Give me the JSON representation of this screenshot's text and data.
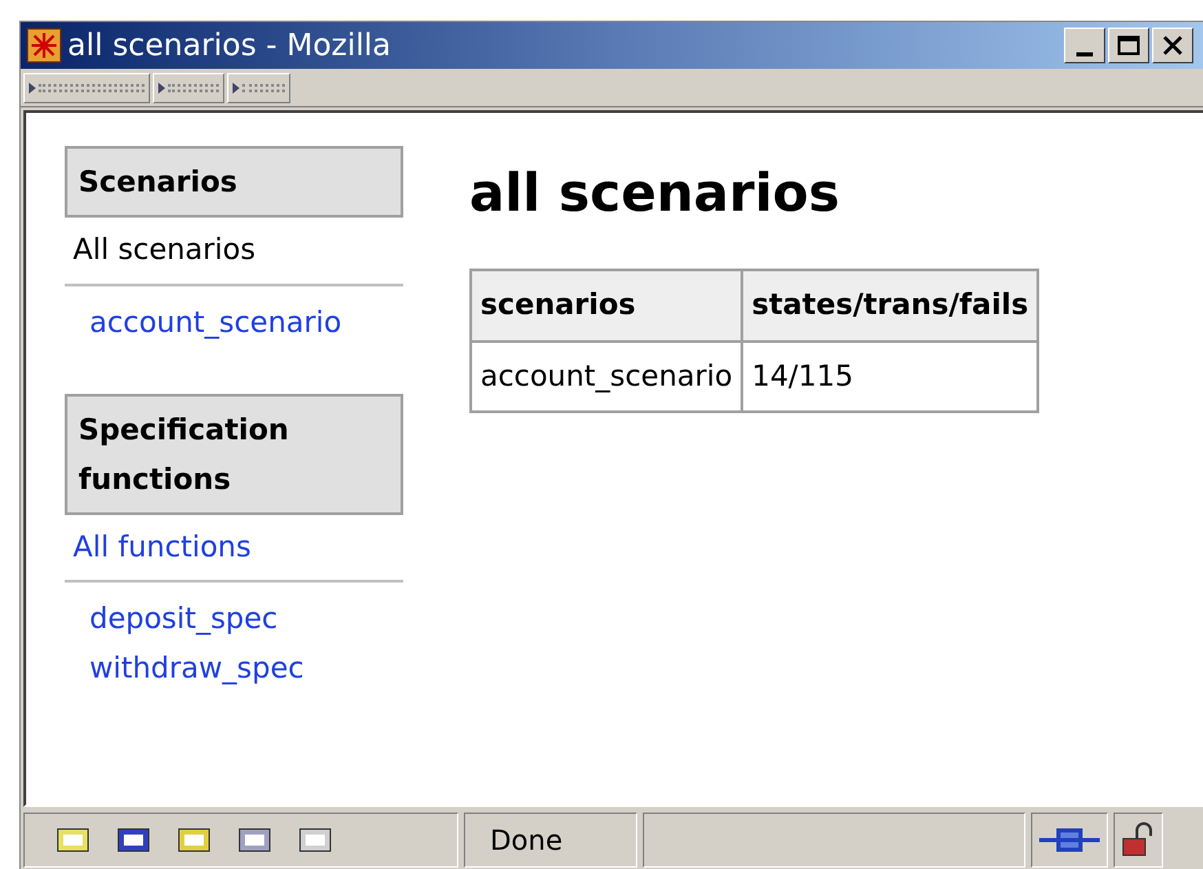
{
  "window": {
    "title": "all scenarios - Mozilla"
  },
  "sidebar": [
    {
      "heading": "Scenarios",
      "all_link": {
        "label": "All scenarios",
        "selected": true
      },
      "items": [
        "account_scenario"
      ]
    },
    {
      "heading": "Specification functions",
      "all_link": {
        "label": "All functions",
        "selected": false
      },
      "items": [
        "deposit_spec",
        "withdraw_spec"
      ]
    }
  ],
  "page_title": "all scenarios",
  "table": {
    "columns": [
      "scenarios",
      "states/trans/fails"
    ],
    "rows": [
      [
        "account_scenario",
        "14/115"
      ]
    ]
  },
  "status_bar": {
    "status": "Done"
  }
}
